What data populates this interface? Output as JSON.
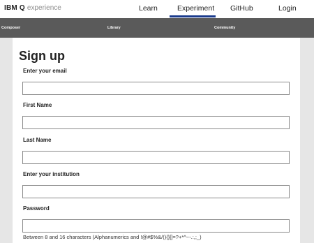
{
  "header": {
    "brand_bold": "IBM Q",
    "brand_light": "experience",
    "nav": {
      "learn": "Learn",
      "experiment": "Experiment",
      "github": "GitHub",
      "login": "Login"
    },
    "active_tab": "Experiment",
    "accent_color": "#1a3a8c"
  },
  "subnav": {
    "composer": "Composer",
    "library": "Library",
    "community": "Community"
  },
  "form": {
    "title": "Sign up",
    "email_label": "Enter your email",
    "first_name_label": "First Name",
    "last_name_label": "Last Name",
    "institution_label": "Enter your institution",
    "password_label": "Password",
    "password_hint": "Between 8 and 16 characters (Alphanumerics and !@#$%&/(){}[]=?+*^~-.:,;_)"
  }
}
